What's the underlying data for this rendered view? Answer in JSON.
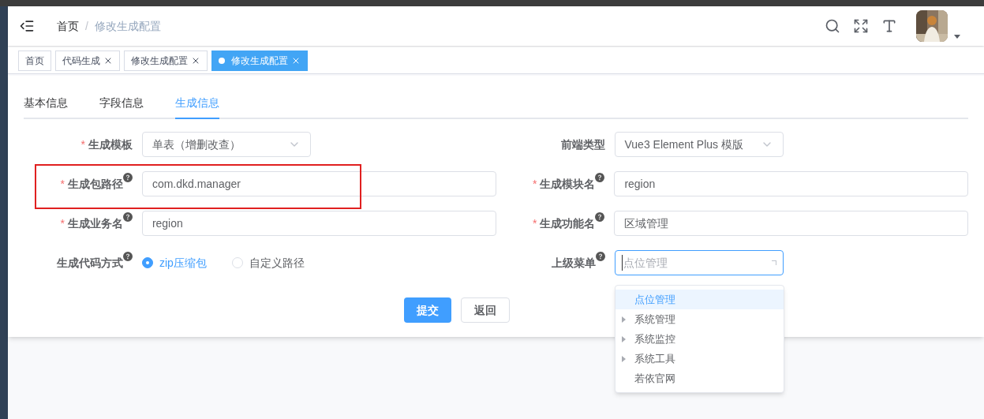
{
  "breadcrumb": {
    "items": [
      "首页",
      "修改生成配置"
    ],
    "separator": "/"
  },
  "tags": [
    {
      "label": "首页",
      "closable": false,
      "selected": false
    },
    {
      "label": "代码生成",
      "closable": true,
      "selected": false
    },
    {
      "label": "修改生成配置",
      "closable": true,
      "selected": false
    },
    {
      "label": "修改生成配置",
      "closable": true,
      "selected": true
    }
  ],
  "tabs": [
    {
      "label": "基本信息",
      "selected": false
    },
    {
      "label": "字段信息",
      "selected": false
    },
    {
      "label": "生成信息",
      "selected": true
    }
  ],
  "fields": [
    {
      "kind": "select",
      "label": "生成模板",
      "required_mark": "*",
      "help": false,
      "value": "单表（增删改查）"
    },
    {
      "kind": "select",
      "label": "前端类型",
      "help": false,
      "value": "Vue3 Element Plus 模版"
    },
    {
      "kind": "input",
      "label": "生成包路径",
      "required_mark": "*",
      "help": true,
      "value": "com.dkd.manager",
      "highlighted": true
    },
    {
      "kind": "input",
      "label": "生成模块名",
      "required_mark": "*",
      "help": true,
      "value": "region"
    },
    {
      "kind": "input",
      "label": "生成业务名",
      "required_mark": "*",
      "help": true,
      "value": "region"
    },
    {
      "kind": "input",
      "label": "生成功能名",
      "required_mark": "*",
      "help": true,
      "value": "区域管理"
    },
    {
      "kind": "radio",
      "label": "生成代码方式",
      "help": true,
      "options": [
        {
          "label": "zip压缩包",
          "selected": true
        },
        {
          "label": "自定义路径",
          "selected": false
        }
      ]
    },
    {
      "kind": "cascader",
      "label": "上级菜单",
      "help": true,
      "placeholder": "点位管理",
      "focused": true,
      "menu": [
        {
          "label": "点位管理",
          "selected": true,
          "expandable": false
        },
        {
          "label": "系统管理",
          "selected": false,
          "expandable": true
        },
        {
          "label": "系统监控",
          "selected": false,
          "expandable": true
        },
        {
          "label": "系统工具",
          "selected": false,
          "expandable": true
        },
        {
          "label": "若依官网",
          "selected": false,
          "expandable": false
        }
      ]
    }
  ],
  "buttons": [
    {
      "label": "提交",
      "kind": "primary"
    },
    {
      "label": "返回",
      "kind": "default"
    }
  ]
}
